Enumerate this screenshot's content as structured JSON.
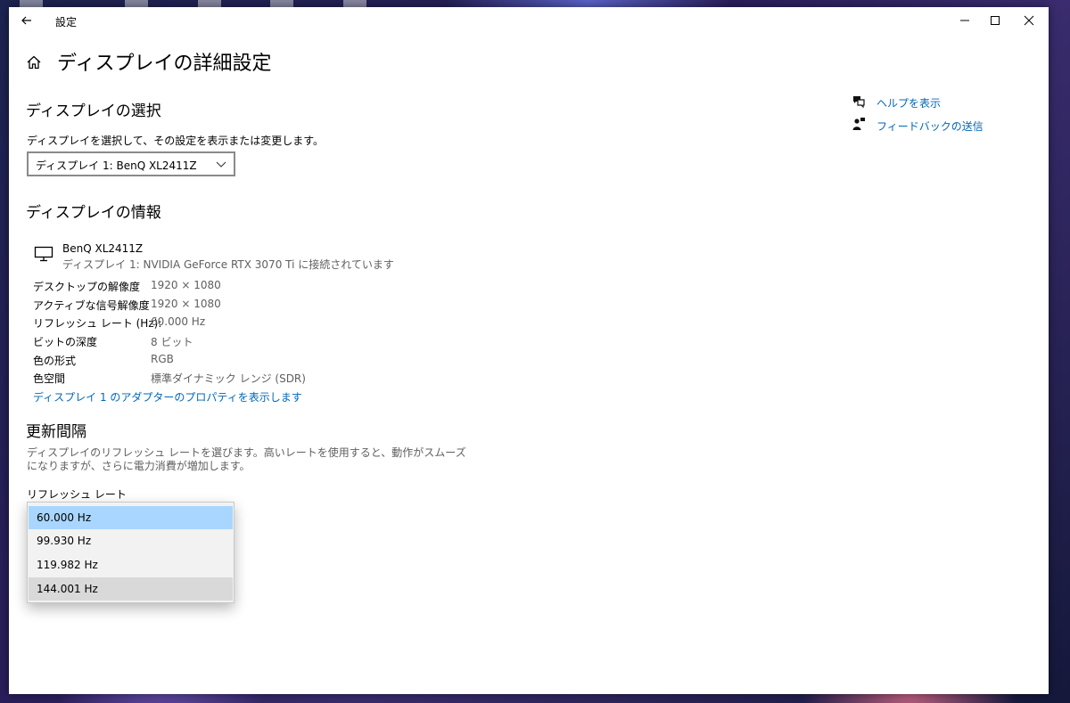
{
  "window": {
    "title": "設定"
  },
  "page": {
    "title": "ディスプレイの詳細設定"
  },
  "select_display": {
    "heading": "ディスプレイの選択",
    "description": "ディスプレイを選択して、その設定を表示または変更します。",
    "selected": "ディスプレイ 1: BenQ XL2411Z"
  },
  "display_info": {
    "heading": "ディスプレイの情報",
    "monitor_name": "BenQ XL2411Z",
    "monitor_sub": "ディスプレイ 1: NVIDIA GeForce RTX 3070 Ti に接続されています",
    "rows": [
      {
        "label": "デスクトップの解像度",
        "value": "1920 × 1080"
      },
      {
        "label": "アクティブな信号解像度",
        "value": "1920 × 1080"
      },
      {
        "label": "リフレッシュ レート (Hz):",
        "value": "60.000 Hz"
      },
      {
        "label": "ビットの深度",
        "value": "8 ビット"
      },
      {
        "label": "色の形式",
        "value": "RGB"
      },
      {
        "label": "色空間",
        "value": "標準ダイナミック レンジ (SDR)"
      }
    ],
    "adapter_link": "ディスプレイ 1 のアダプターのプロパティを表示します"
  },
  "refresh": {
    "heading": "更新間隔",
    "description_line1": "ディスプレイのリフレッシュ レートを選びます。高いレートを使用すると、動作がスムーズ",
    "description_line2": "になりますが、さらに電力消費が増加します。",
    "label": "リフレッシュ レート",
    "options": [
      "60.000 Hz",
      "99.930 Hz",
      "119.982 Hz",
      "144.001 Hz"
    ]
  },
  "side": {
    "help": "ヘルプを表示",
    "feedback": "フィードバックの送信"
  },
  "icons": {
    "back": "back-arrow-icon",
    "home": "home-icon",
    "minimize": "minimize-icon",
    "maximize": "maximize-icon",
    "close": "close-icon",
    "chevron": "chevron-down-icon",
    "monitor": "monitor-icon",
    "help": "help-chat-icon",
    "feedback": "feedback-person-icon"
  },
  "colors": {
    "link": "#0067b8",
    "selected_option": "#a9d6ff",
    "hover_option": "#d9d9d9"
  }
}
